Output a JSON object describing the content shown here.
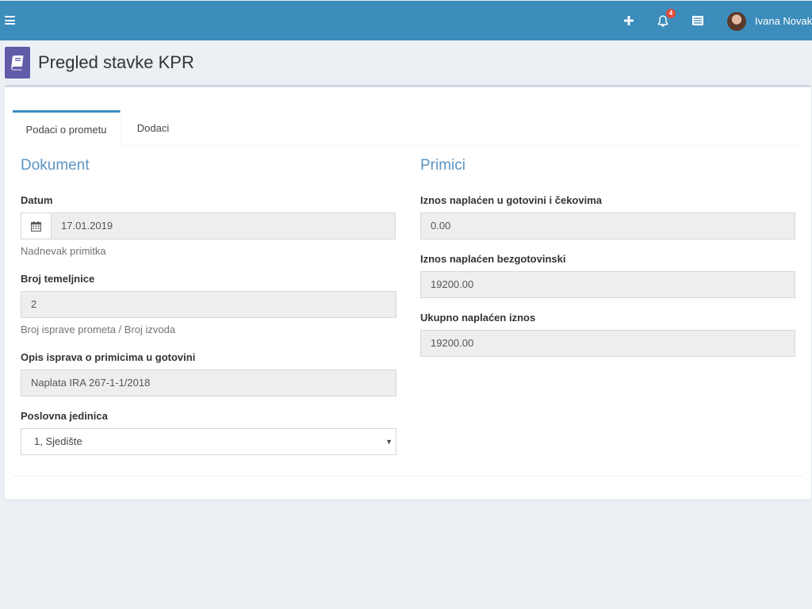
{
  "header": {
    "user_name": "Ivana Novak",
    "notification_count": "4",
    "colors": {
      "bar": "#3c8dbc",
      "badge": "#dd4b39"
    }
  },
  "page": {
    "title": "Pregled stavke KPR",
    "icon": "book-icon",
    "icon_color": "#605ca8"
  },
  "tabs": [
    {
      "label": "Podaci o prometu",
      "active": true
    },
    {
      "label": "Dodaci",
      "active": false
    }
  ],
  "dokument": {
    "section_title": "Dokument",
    "datum_label": "Datum",
    "datum_value": "17.01.2019",
    "datum_help": "Nadnevak primitka",
    "broj_label": "Broj temeljnice",
    "broj_value": "2",
    "broj_help": "Broj isprave prometa / Broj izvoda",
    "opis_label": "Opis isprava o primicima u gotovini",
    "opis_value": "Naplata IRA 267-1-1/2018",
    "jedinica_label": "Poslovna jedinica",
    "jedinica_value": "1, Sjedište"
  },
  "primici": {
    "section_title": "Primici",
    "gotovina_label": "Iznos naplaćen u gotovini i čekovima",
    "gotovina_value": "0.00",
    "bezgotovinski_label": "Iznos naplaćen bezgotovinski",
    "bezgotovinski_value": "19200.00",
    "ukupno_label": "Ukupno naplaćen iznos",
    "ukupno_value": "19200.00"
  }
}
